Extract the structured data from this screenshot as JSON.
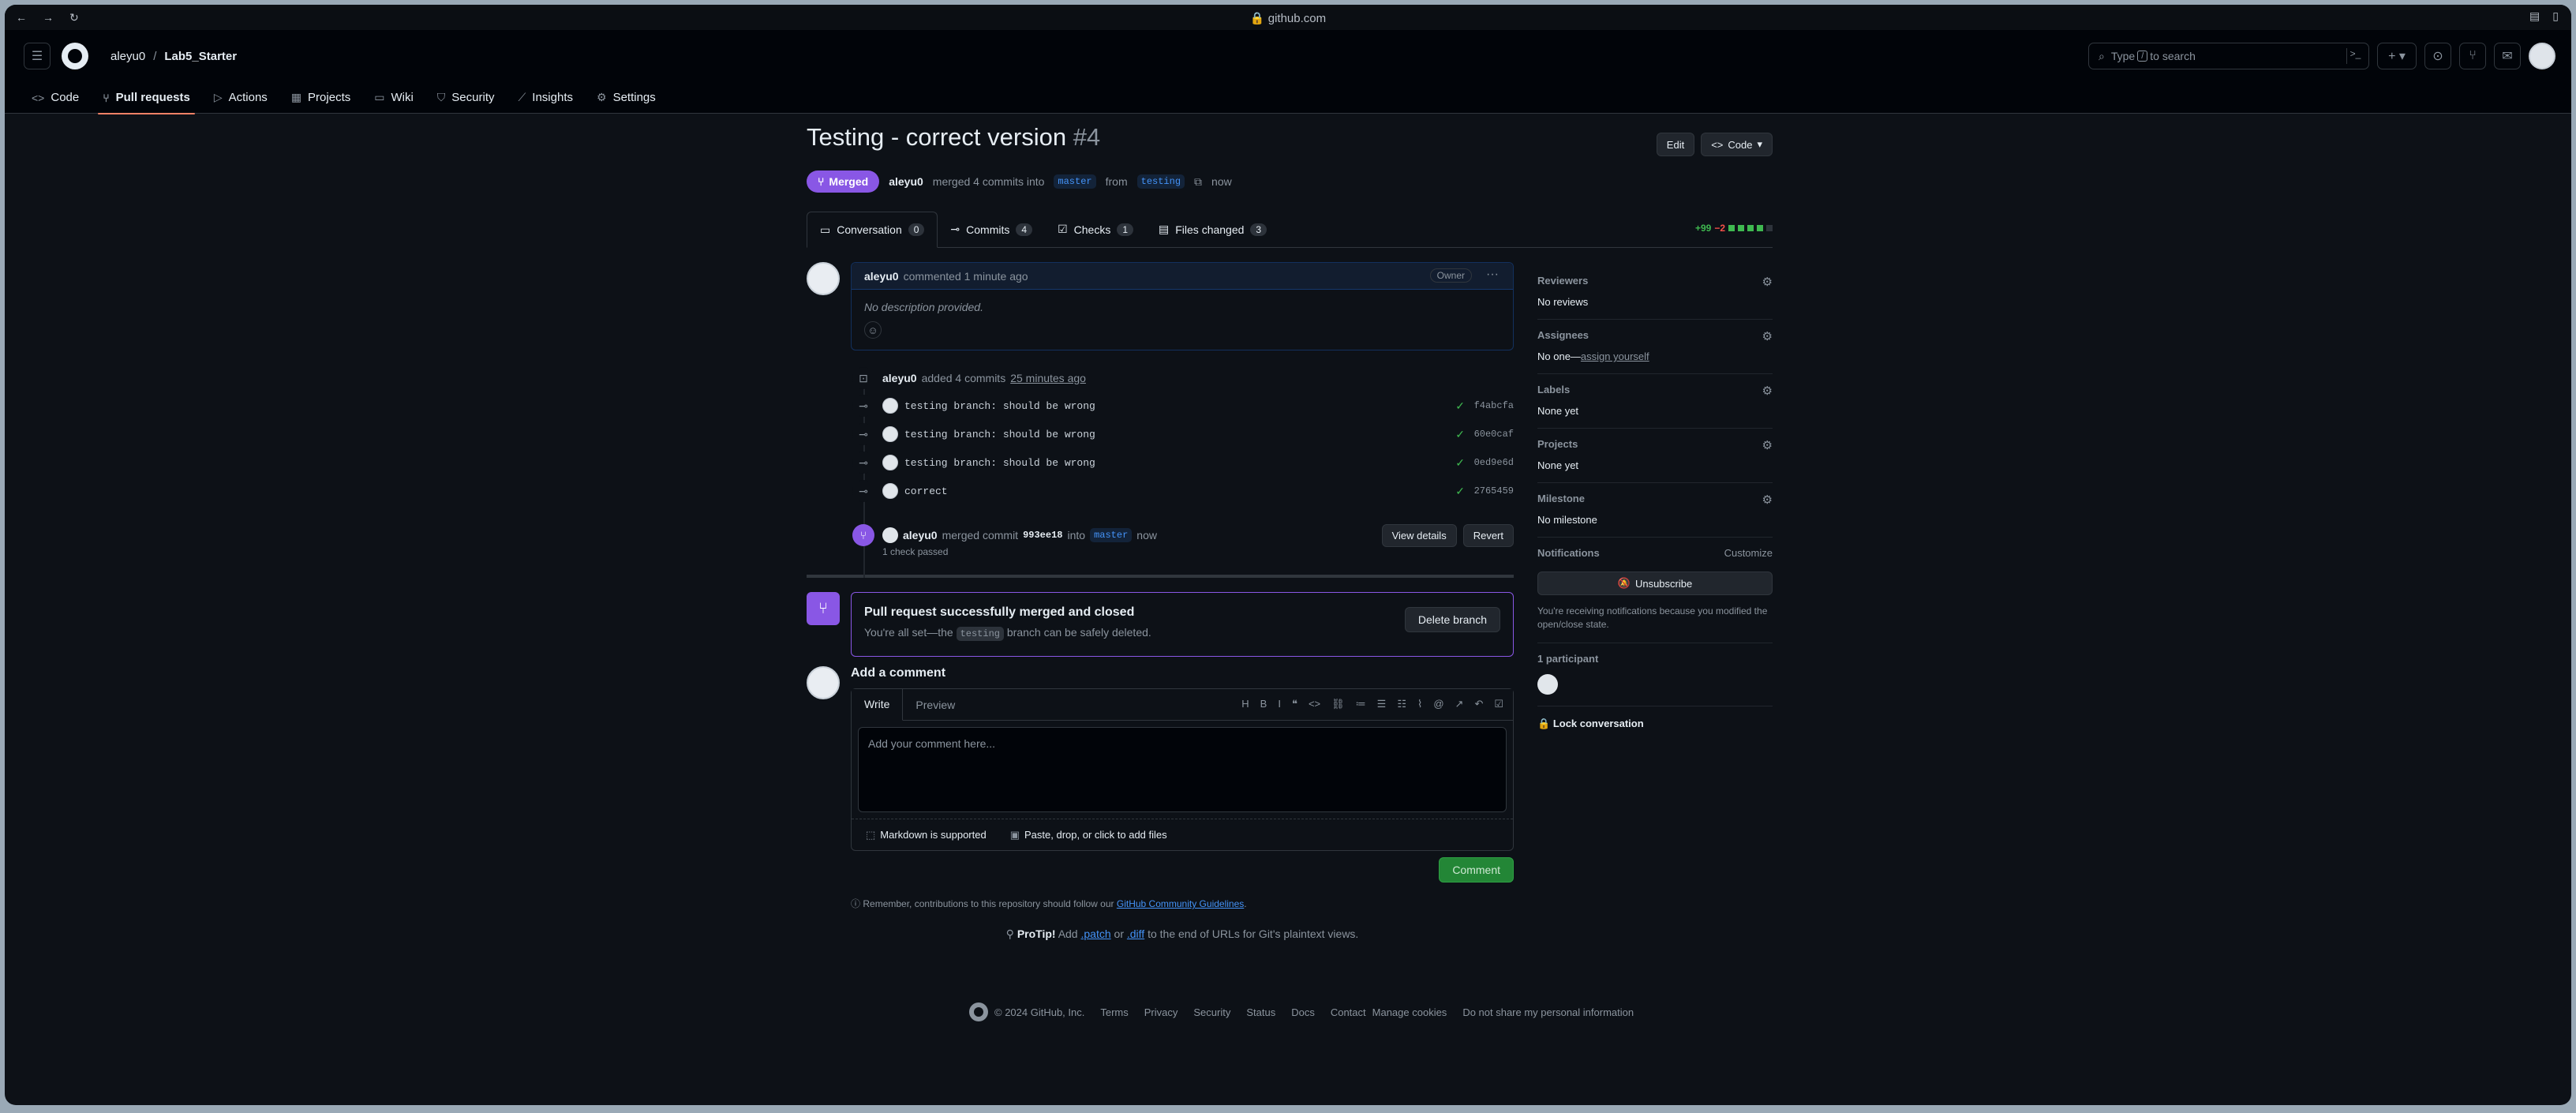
{
  "browser": {
    "url": "github.com"
  },
  "header": {
    "owner": "aleyu0",
    "separator": "/",
    "repo": "Lab5_Starter",
    "search_pre": "Type",
    "search_key": "/",
    "search_post": "to search"
  },
  "repo_tabs": [
    {
      "label": "Code",
      "icon": "code-icon"
    },
    {
      "label": "Pull requests",
      "icon": "pull-request-icon"
    },
    {
      "label": "Actions",
      "icon": "play-icon"
    },
    {
      "label": "Projects",
      "icon": "table-icon"
    },
    {
      "label": "Wiki",
      "icon": "book-icon"
    },
    {
      "label": "Security",
      "icon": "shield-icon"
    },
    {
      "label": "Insights",
      "icon": "graph-icon"
    },
    {
      "label": "Settings",
      "icon": "gear-icon"
    }
  ],
  "pr": {
    "title": "Testing - correct version",
    "number": "#4",
    "edit_label": "Edit",
    "code_label": "Code",
    "state": "Merged",
    "author": "aleyu0",
    "merge_text": "merged 4 commits into",
    "base": "master",
    "from_text": "from",
    "head": "testing",
    "time": "now"
  },
  "pr_tabs": [
    {
      "label": "Conversation",
      "count": "0"
    },
    {
      "label": "Commits",
      "count": "4"
    },
    {
      "label": "Checks",
      "count": "1"
    },
    {
      "label": "Files changed",
      "count": "3"
    }
  ],
  "diffstat": {
    "additions": "+99",
    "deletions": "−2"
  },
  "comment": {
    "author": "aleyu0",
    "action": "commented 1 minute ago",
    "badge": "Owner",
    "body": "No description provided."
  },
  "commits_event": {
    "author": "aleyu0",
    "text": "added 4 commits",
    "time": "25 minutes ago"
  },
  "commits": [
    {
      "message": "testing branch: should be wrong",
      "sha": "f4abcfa"
    },
    {
      "message": "testing branch: should be wrong",
      "sha": "60e0caf"
    },
    {
      "message": "testing branch: should be wrong",
      "sha": "0ed9e6d"
    },
    {
      "message": "correct",
      "sha": "2765459"
    }
  ],
  "merge_event": {
    "author": "aleyu0",
    "text": "merged commit",
    "sha": "993ee18",
    "into": "into",
    "branch": "master",
    "time": "now",
    "checks": "1 check passed",
    "view_details": "View details",
    "revert": "Revert"
  },
  "merged_box": {
    "title": "Pull request successfully merged and closed",
    "text_before": "You're all set—the",
    "branch": "testing",
    "text_after": "branch can be safely deleted.",
    "delete_label": "Delete branch"
  },
  "composer": {
    "heading": "Add a comment",
    "write_tab": "Write",
    "preview_tab": "Preview",
    "placeholder": "Add your comment here...",
    "markdown": "Markdown is supported",
    "attach": "Paste, drop, or click to add files",
    "submit": "Comment"
  },
  "note": {
    "text": "Remember, contributions to this repository should follow our",
    "link": "GitHub Community Guidelines",
    "end": "."
  },
  "protip": {
    "label": "ProTip!",
    "t1": "Add",
    "l1": ".patch",
    "t2": "or",
    "l2": ".diff",
    "t3": "to the end of URLs for Git's plaintext views."
  },
  "sidebar": {
    "reviewers_label": "Reviewers",
    "reviewers_val": "No reviews",
    "assignees_label": "Assignees",
    "assignees_val": "No one—",
    "assignees_link": "assign yourself",
    "labels_label": "Labels",
    "labels_val": "None yet",
    "projects_label": "Projects",
    "projects_val": "None yet",
    "milestone_label": "Milestone",
    "milestone_val": "No milestone",
    "notifications_label": "Notifications",
    "customize": "Customize",
    "unsubscribe": "Unsubscribe",
    "notif_text": "You're receiving notifications because you modified the open/close state.",
    "participants": "1 participant",
    "lock": "Lock conversation"
  },
  "footer": {
    "copyright": "© 2024 GitHub, Inc.",
    "links": [
      "Terms",
      "Privacy",
      "Security",
      "Status",
      "Docs",
      "Contact",
      "Manage cookies",
      "Do not share my personal information"
    ]
  }
}
